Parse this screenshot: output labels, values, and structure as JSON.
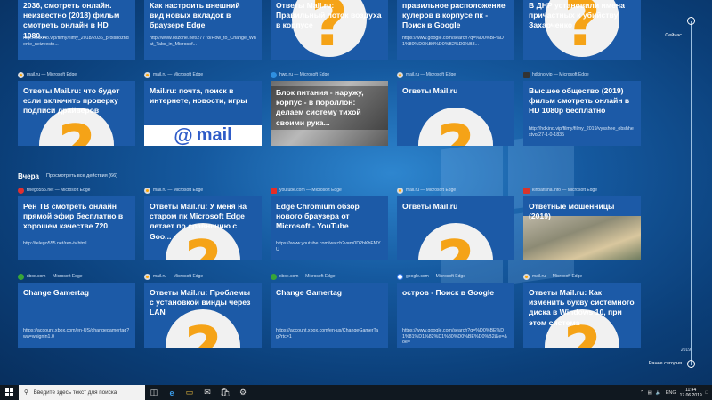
{
  "colors": {
    "tile": "#1c5aa7",
    "background": "#15599f",
    "taskbar": "#101820",
    "question_mark": "#f5a317"
  },
  "top_row": [
    {
      "title": "2036, смотреть онлайн. неизвестно (2018) фильм смотреть онлайн в HD 1080...",
      "url": "http://hdkino.vip/filmy/filmy_2018/2036_proishozhdenie_neizvestn..."
    },
    {
      "title": "Как настроить внешний вид новых вкладок в браузере Edge",
      "url": "http://www.oszone.net/27778/How_to_Change_What_Tabs_in_Microsof..."
    },
    {
      "title": "Ответы Mail.ru: Правильный поток воздуха в корпусе",
      "url": ""
    },
    {
      "title": "правильное расположение кулеров в корпусе пк - Поиск в Google",
      "url": "https://www.google.com/search?q=%D0%BF%D1%80%D0%B0%D0%B2%D0%B8..."
    },
    {
      "title": "В ДНР установили имена причастных к убийству Захарченко",
      "url": ""
    }
  ],
  "row2": [
    {
      "source": "mail.ru — Microsoft Edge",
      "title": "Ответы Mail.ru: что будет если включить проверку подписи драйверов",
      "url": "",
      "icon": "mail"
    },
    {
      "source": "mail.ru — Microsoft Edge",
      "title": "Mail.ru: почта, поиск в интернете, новости, игры",
      "url": "",
      "icon": "mail",
      "thumb_text": "mail"
    },
    {
      "source": "hwp.ru — Microsoft Edge",
      "title": "Блок питания - наружу, корпус - в пороллон: делаем систему тихой своими рука...",
      "url": "",
      "icon": "edge"
    },
    {
      "source": "mail.ru — Microsoft Edge",
      "title": "Ответы Mail.ru",
      "url": "",
      "icon": "mail"
    },
    {
      "source": "hdkino.vip — Microsoft Edge",
      "title": "Высшее общество (2019) фильм смотреть онлайн в HD 1080p бесплатно",
      "url": "http://hdkino.vip/filmy/filmy_2019/vysshee_obshhestvo/27-1-0-1835",
      "icon": "hd"
    }
  ],
  "section": {
    "label": "Вчера",
    "link": "Просмотреть все действия (66)"
  },
  "row3": [
    {
      "source": "telego555.net — Microsoft Edge",
      "title": "Рен ТВ смотреть онлайн прямой эфир бесплатно в хорошем качестве 720",
      "url": "http://telego555.net/ren-tv.html",
      "icon": "t"
    },
    {
      "source": "mail.ru — Microsoft Edge",
      "title": "Ответы Mail.ru: У меня на старом пк Microsoft Edge летает по сравнению с Goo...",
      "url": "",
      "icon": "mail"
    },
    {
      "source": "youtube.com — Microsoft Edge",
      "title": "Edge Chromium обзор нового браузера от Microsoft - YouTube",
      "url": "https://www.youtube.com/watch?v=m0D2bKhFMYU",
      "icon": "yt"
    },
    {
      "source": "mail.ru — Microsoft Edge",
      "title": "Ответы Mail.ru",
      "url": "",
      "icon": "mail"
    },
    {
      "source": "kinoafisha.info — Microsoft Edge",
      "title": "Ответные мошенницы (2019)",
      "url": "",
      "icon": "ka"
    }
  ],
  "row4": [
    {
      "source": "xbox.com — Microsoft Edge",
      "title": "Change Gamertag",
      "url": "https://account.xbox.com/en-US/changegamertag?wa=wsignin1.0",
      "icon": "xbox"
    },
    {
      "source": "mail.ru — Microsoft Edge",
      "title": "Ответы Mail.ru: Проблемы с установкой винды через LAN",
      "url": "",
      "icon": "mail"
    },
    {
      "source": "xbox.com — Microsoft Edge",
      "title": "Change Gamertag",
      "url": "https://account.xbox.com/en-us/ChangeGamerTag?rtc=1",
      "icon": "xbox"
    },
    {
      "source": "google.com — Microsoft Edge",
      "title": "остров - Поиск в Google",
      "url": "https://www.google.com/search?q=%D0%BE%D1%81%D1%82%D1%80%D0%BE%D0%B2&ie=&oe=",
      "icon": "g"
    },
    {
      "source": "mail.ru — Microsoft Edge",
      "title": "Ответы Mail.ru: Как изменить букву системного диска в Windows 10, при этом система",
      "url": "",
      "icon": "mail"
    }
  ],
  "timeline": {
    "now_label": "Сейчас",
    "earlier_label": "Ранее сегодня",
    "year": "2019"
  },
  "taskbar": {
    "search_placeholder": "Введите здесь текст для поиска",
    "lang": "ENG",
    "time": "11:44",
    "date": "17.06.2019"
  }
}
